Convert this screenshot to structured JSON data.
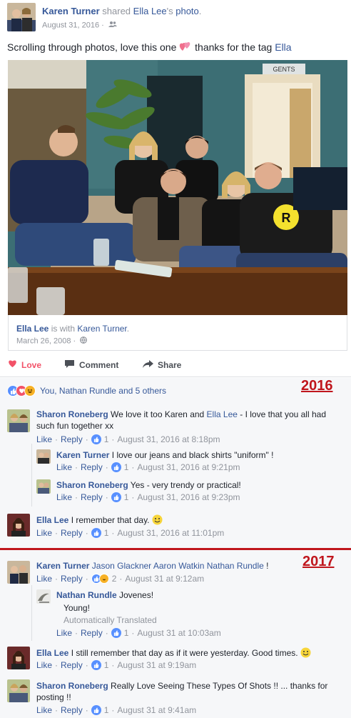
{
  "post": {
    "author": "Karen Turner",
    "action_text": " shared ",
    "shared_from": "Ella Lee",
    "shared_suffix": "'s ",
    "shared_object": "photo",
    "shared_end": ".",
    "date": "August 31, 2016 ·",
    "text_before": "Scrolling through photos, love this one ",
    "text_after": " thanks for the tag ",
    "tag": "Ella"
  },
  "attribution": {
    "name": "Ella Lee",
    "with_text": " is with ",
    "with_name": "Karen Turner",
    "end": ".",
    "date": "March 26, 2008 ·"
  },
  "photo": {
    "sign": "GENTS"
  },
  "actions": {
    "love": "Love",
    "comment": "Comment",
    "share": "Share"
  },
  "reactions": {
    "summary": "You, Nathan Rundle and 5 others"
  },
  "year_labels": {
    "first": "2016",
    "second": "2017"
  },
  "comments": [
    {
      "author": "Sharon Roneberg",
      "text_parts": [
        " We love it too Karen and ",
        "Ella Lee",
        " - I love that you all had such fun together xx"
      ],
      "like": "Like",
      "reply": "Reply",
      "count": "1",
      "time": "August 31, 2016 at 8:18pm"
    },
    {
      "author": "Karen Turner",
      "text": " I love our jeans and black shirts \"uniform\" !",
      "like": "Like",
      "reply": "Reply",
      "count": "1",
      "time": "August 31, 2016 at 9:21pm"
    },
    {
      "author": "Sharon Roneberg",
      "text": " Yes - very trendy or practical!",
      "like": "Like",
      "reply": "Reply",
      "count": "1",
      "time": "August 31, 2016 at 9:23pm"
    },
    {
      "author": "Ella Lee",
      "text": " I remember that day.",
      "like": "Like",
      "reply": "Reply",
      "count": "1",
      "time": "August 31, 2016 at 11:01pm"
    },
    {
      "author": "Karen Turner",
      "tags": " Jason Glackner Aaron Watkin Nathan Rundle",
      "text": " !",
      "like": "Like",
      "reply": "Reply",
      "count": "2",
      "time": "August 31 at 9:12am"
    },
    {
      "author": "Nathan Rundle",
      "text": " Jovenes!",
      "translation": "Young!",
      "translated_label": "Automatically Translated",
      "like": "Like",
      "reply": "Reply",
      "count": "1",
      "time": "August 31 at 10:03am"
    },
    {
      "author": "Ella Lee",
      "text": " I still remember that day as if it were yesterday. Good times.",
      "like": "Like",
      "reply": "Reply",
      "count": "1",
      "time": "August 31 at 9:19am"
    },
    {
      "author": "Sharon Roneberg",
      "text": " Really Love Seeing These Types Of Shots !! ... thanks for posting !!",
      "like": "Like",
      "reply": "Reply",
      "count": "1",
      "time": "August 31 at 9:41am"
    }
  ],
  "colors": {
    "link": "#365899",
    "love": "#f25268",
    "like_blue": "#5890ff",
    "year_red": "#c0161d"
  }
}
